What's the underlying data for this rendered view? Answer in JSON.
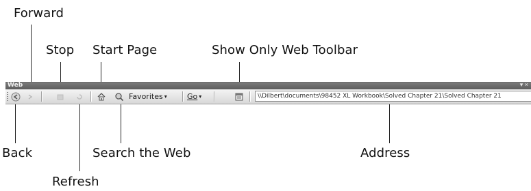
{
  "callouts": {
    "forward": "Forward",
    "stop": "Stop",
    "start_page": "Start Page",
    "show_only_web_toolbar": "Show Only Web Toolbar",
    "back": "Back",
    "search_the_web": "Search the Web",
    "address": "Address",
    "refresh": "Refresh"
  },
  "toolbar": {
    "title": "Web",
    "title_controls": "▾ ×",
    "favorites_label": "Favorites",
    "go_label": "Go",
    "address_value": "\\\\Dilbert\\documents\\98452 XL Workbook\\Solved Chapter 21\\Solved Chapter 21"
  },
  "icons": {
    "back": "back-arrow-icon",
    "forward": "forward-arrow-icon",
    "stop": "stop-icon",
    "refresh": "refresh-icon",
    "start_page": "home-icon",
    "search": "search-globe-icon",
    "show_only": "window-toolbar-icon"
  },
  "colors": {
    "titlebar": "#6b6b6b",
    "toolbar": "#e6e6e6",
    "text": "#111111"
  }
}
